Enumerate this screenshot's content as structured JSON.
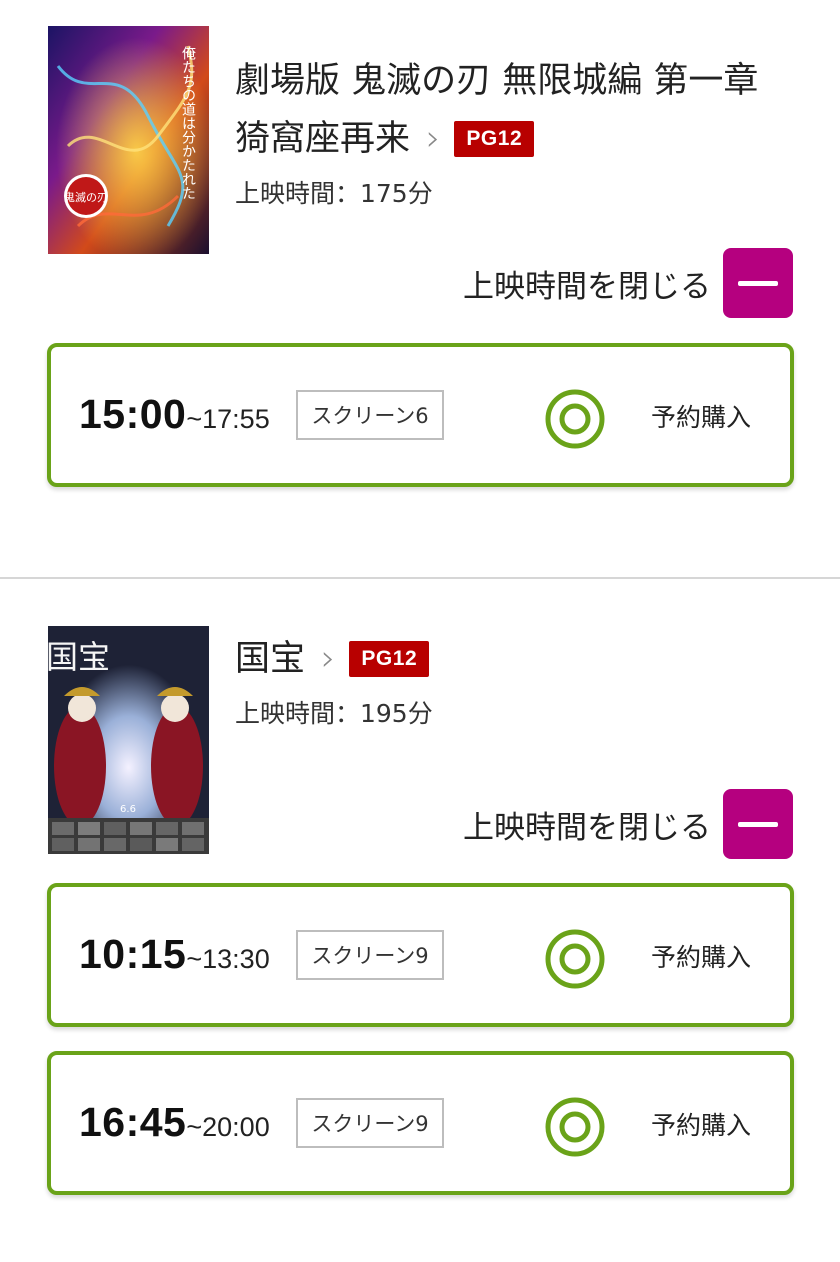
{
  "movies": [
    {
      "title_line1": "劇場版 鬼滅の刃 無限城編 第一章",
      "title_line2": "猗窩座再来",
      "rating": "PG12",
      "runtime": "上映時間：175分",
      "close_label": "上映時間を閉じる",
      "poster_text": "俺たちの道は分かたれた",
      "poster_logo": "鬼滅の刃",
      "showtimes": [
        {
          "start": "15:00",
          "end": "~17:55",
          "screen": "スクリーン6",
          "buy_label": "予約購入",
          "availability": "double-circle-icon"
        }
      ]
    },
    {
      "title_line1": "国宝",
      "rating": "PG12",
      "runtime": "上映時間：195分",
      "close_label": "上映時間を閉じる",
      "poster_title": "国宝",
      "poster_date": "6.6",
      "showtimes": [
        {
          "start": "10:15",
          "end": "~13:30",
          "screen": "スクリーン9",
          "buy_label": "予約購入",
          "availability": "double-circle-icon"
        },
        {
          "start": "16:45",
          "end": "~20:00",
          "screen": "スクリーン9",
          "buy_label": "予約購入",
          "availability": "double-circle-icon"
        }
      ]
    }
  ],
  "colors": {
    "rating_badge": "#b80000",
    "close_button": "#b5007f",
    "showtime_border": "#6aa319",
    "availability_icon": "#6aa319"
  }
}
